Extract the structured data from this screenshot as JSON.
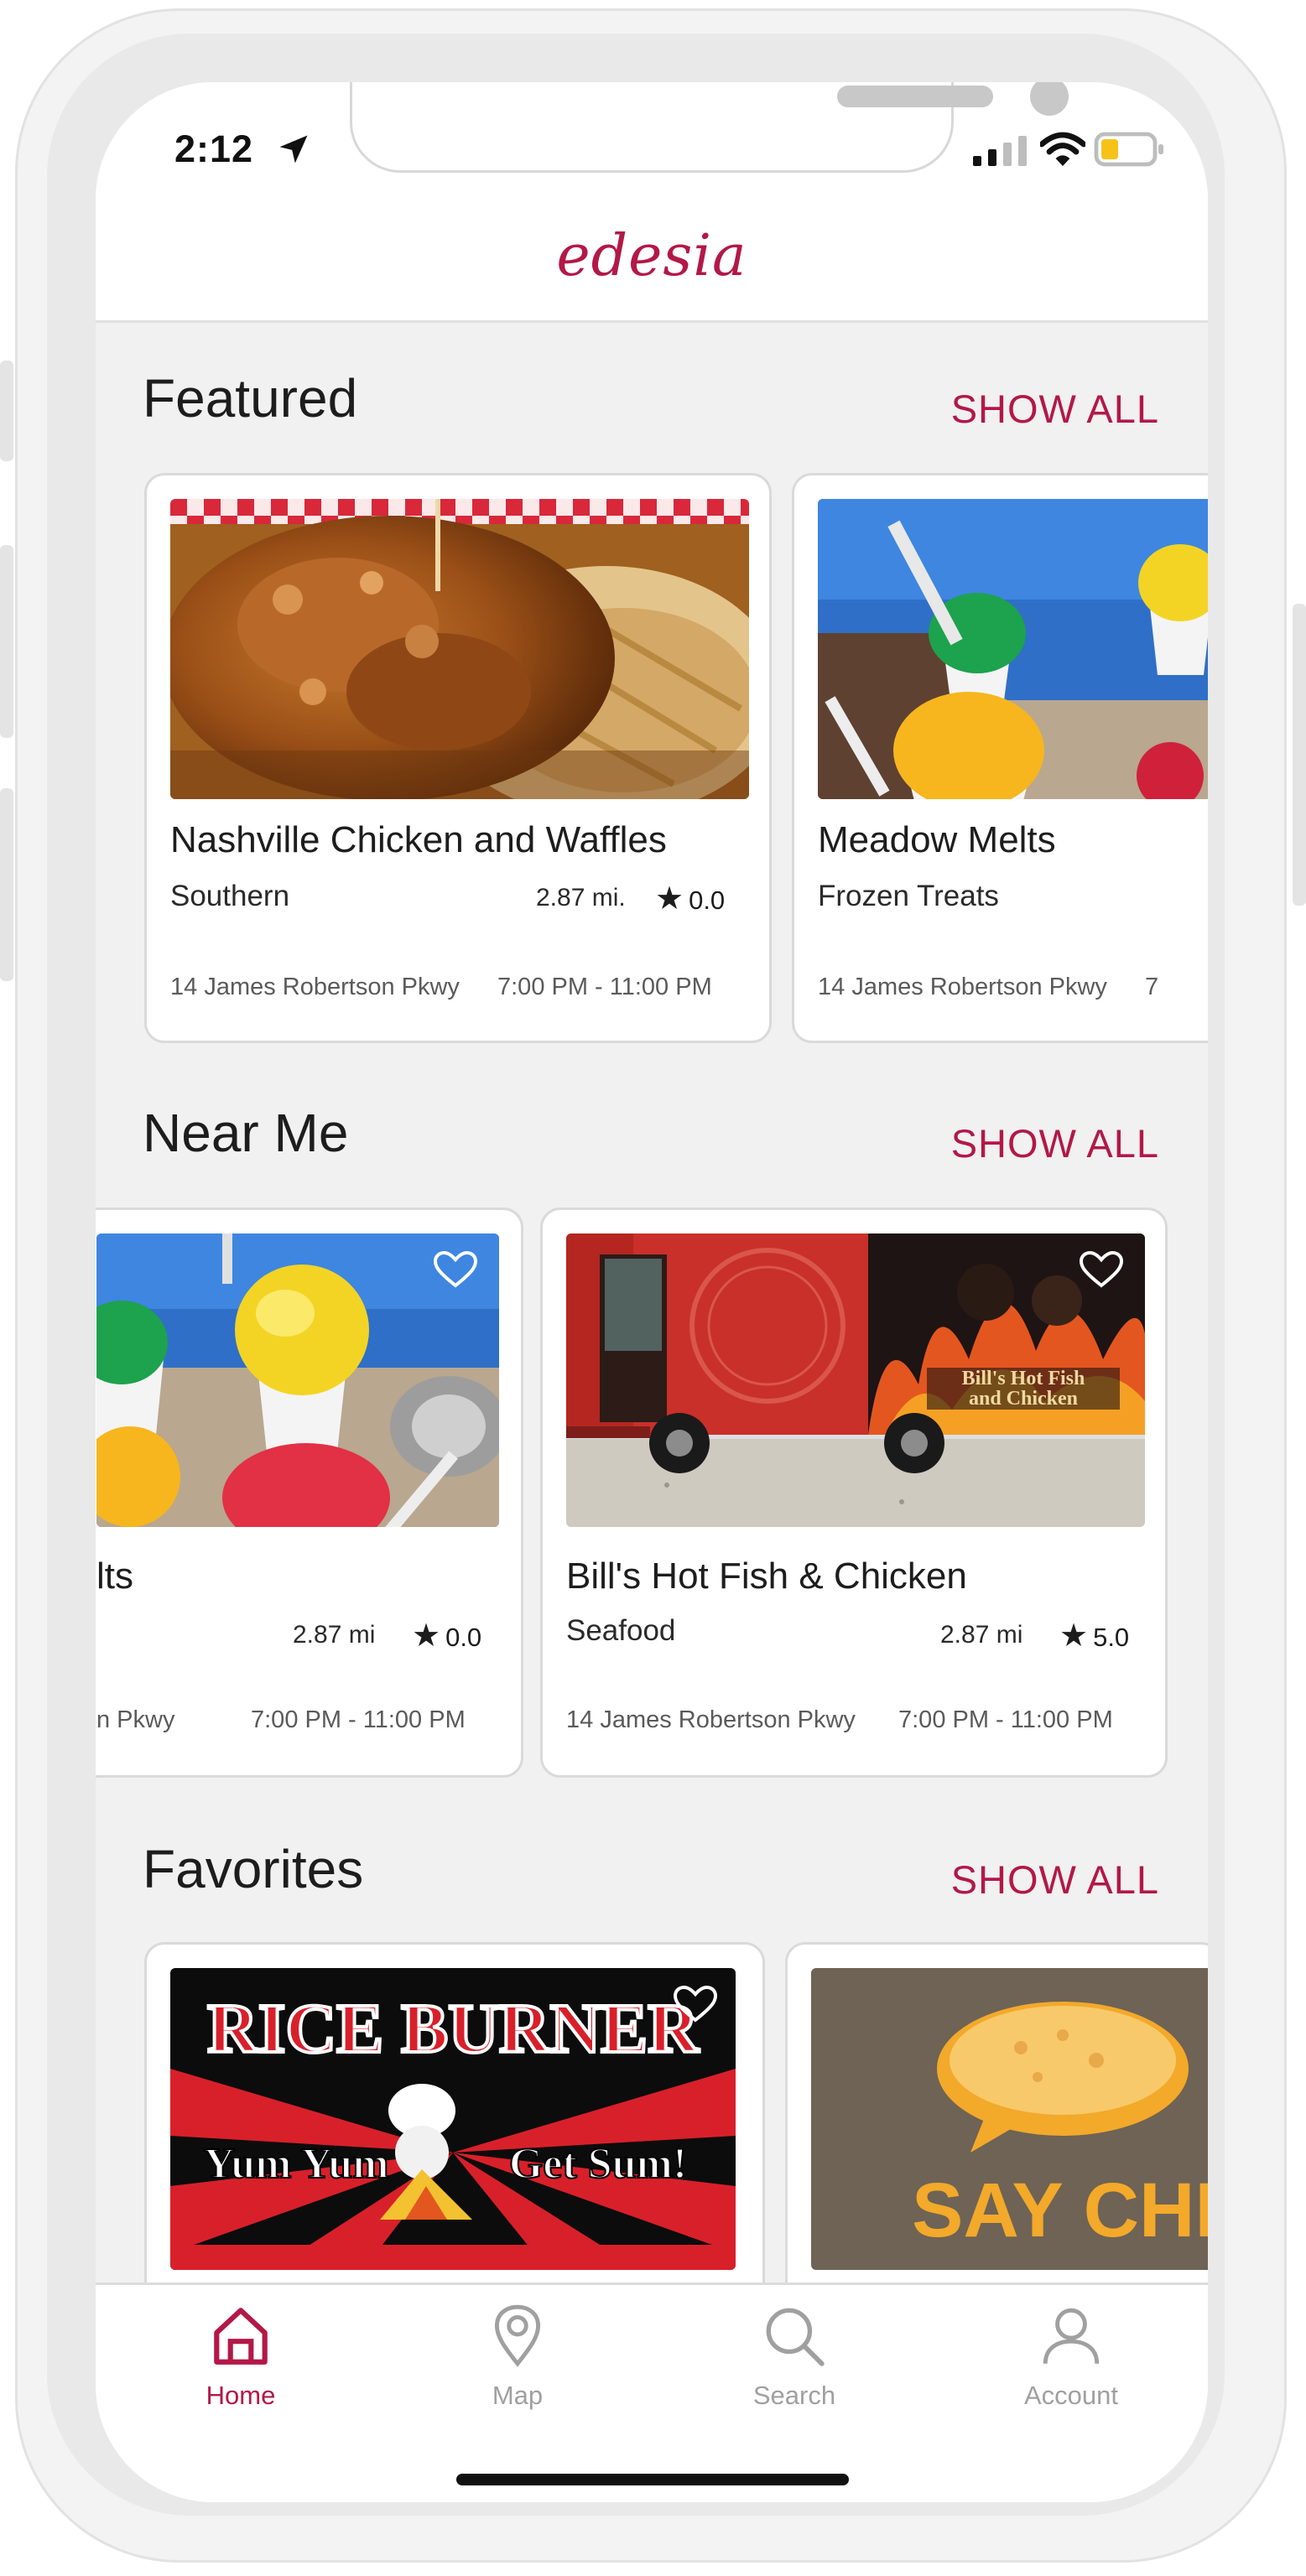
{
  "status_bar": {
    "time": "2:12"
  },
  "header": {
    "brand": "edesia"
  },
  "sections": {
    "featured": {
      "title": "Featured",
      "show_all": "SHOW ALL",
      "cards": [
        {
          "name": "Nashville Chicken and Waffles",
          "category": "Southern",
          "distance": "2.87 mi.",
          "rating": "0.0",
          "address": "14 James Robertson Pkwy",
          "hours": "7:00 PM - 11:00 PM"
        },
        {
          "name": "Meadow Melts",
          "category": "Frozen Treats",
          "address": "14 James Robertson Pkwy",
          "hours": "7"
        }
      ]
    },
    "near_me": {
      "title": "Near Me",
      "show_all": "SHOW ALL",
      "cards": [
        {
          "name": "lts",
          "distance": "2.87 mi",
          "rating": "0.0",
          "address": "n Pkwy",
          "hours": "7:00 PM - 11:00 PM"
        },
        {
          "name": "Bill's Hot Fish & Chicken",
          "category": "Seafood",
          "distance": "2.87 mi",
          "rating": "5.0",
          "address": "14 James Robertson Pkwy",
          "hours": "7:00 PM - 11:00 PM"
        }
      ]
    },
    "favorites": {
      "title": "Favorites",
      "show_all": "SHOW ALL",
      "cards": [
        {
          "image_text_top": "RICE BURNER",
          "image_text_left": "Yum Yum",
          "image_text_right": "Get Sum!"
        },
        {
          "image_text": "SAY CHEE"
        }
      ]
    }
  },
  "tab_bar": {
    "items": [
      {
        "label": "Home",
        "icon": "home-icon",
        "active": true
      },
      {
        "label": "Map",
        "icon": "map-pin-icon",
        "active": false
      },
      {
        "label": "Search",
        "icon": "search-icon",
        "active": false
      },
      {
        "label": "Account",
        "icon": "account-icon",
        "active": false
      }
    ]
  },
  "colors": {
    "accent": "#b31847",
    "inactive_tab": "#a0a0a0",
    "background": "#f1f1f1"
  }
}
